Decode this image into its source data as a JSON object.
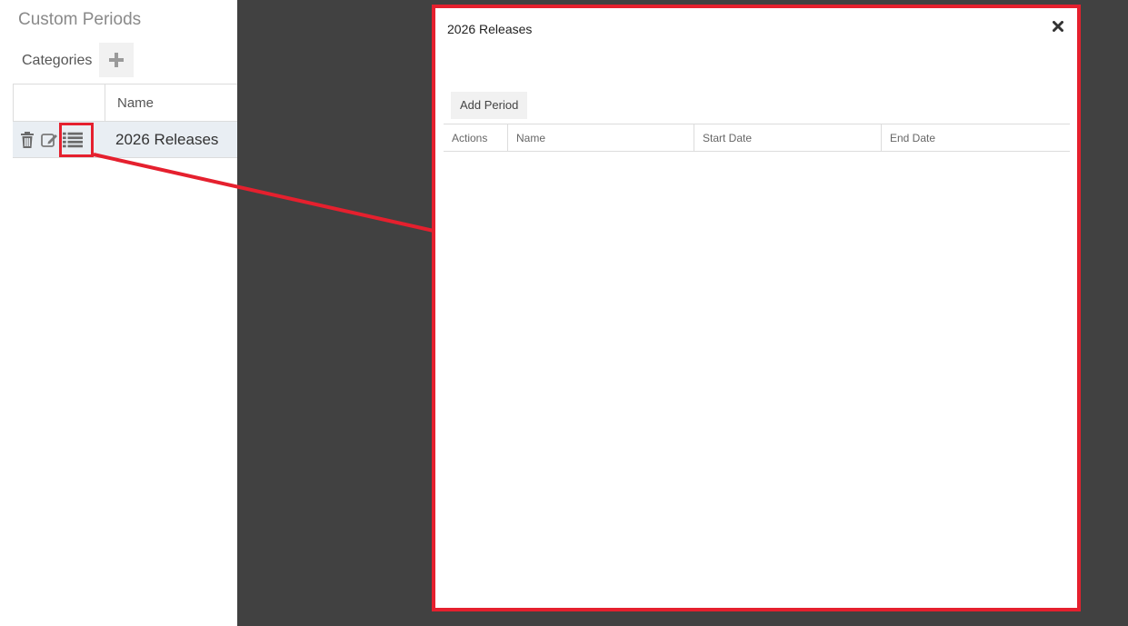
{
  "page": {
    "title": "Custom Periods"
  },
  "categories": {
    "label": "Categories",
    "add_icon": "plus-icon",
    "columns": {
      "name": "Name"
    },
    "rows": [
      {
        "name": "2026 Releases",
        "actions": [
          "trash-icon",
          "edit-icon",
          "list-icon"
        ]
      }
    ]
  },
  "dialog": {
    "title": "2026 Releases",
    "close_icon": "close-icon",
    "add_period_label": "Add Period",
    "columns": {
      "actions": "Actions",
      "name": "Name",
      "start_date": "Start Date",
      "end_date": "End Date"
    },
    "rows": []
  },
  "colors": {
    "highlight": "#e5202e",
    "overlay": "#414141",
    "row_selected": "#e9eef3"
  }
}
